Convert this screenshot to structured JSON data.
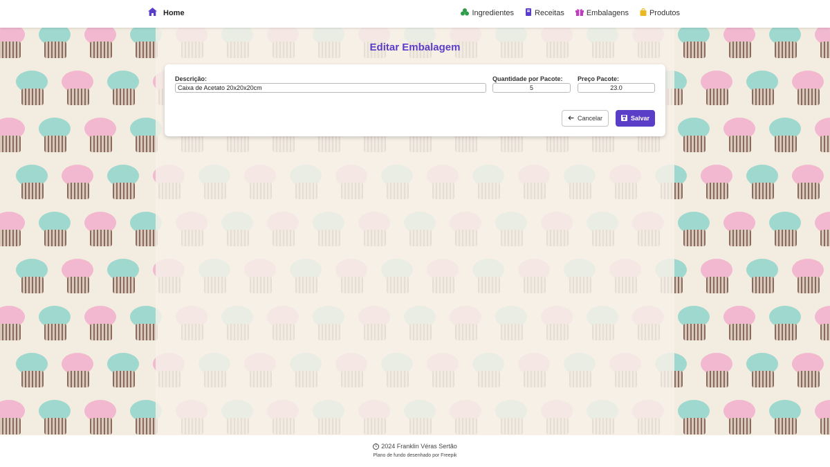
{
  "nav": {
    "home_label": "Home",
    "items": [
      {
        "label": "Ingredientes",
        "icon": "ingredients-icon",
        "color": "#2e9d4a"
      },
      {
        "label": "Receitas",
        "icon": "recipe-book-icon",
        "color": "#5a3ec8"
      },
      {
        "label": "Embalagens",
        "icon": "gift-box-icon",
        "color": "#c03cc0"
      },
      {
        "label": "Produtos",
        "icon": "shopping-bag-icon",
        "color": "#e8b923"
      }
    ]
  },
  "page": {
    "title": "Editar Embalagem"
  },
  "form": {
    "descricao_label": "Descrição:",
    "descricao_value": "Caixa de Acetato 20x20x20cm",
    "quantidade_label": "Quantidade por Pacote:",
    "quantidade_value": "5",
    "preco_label": "Preço Pacote:",
    "preco_value": "23.0",
    "cancel_label": "Cancelar",
    "save_label": "Salvar"
  },
  "footer": {
    "copyright": "2024 Franklin Véras Sertão",
    "credit": "Plano de fundo desenhado por Freepik"
  },
  "colors": {
    "accent": "#5a3ec8",
    "background_pattern_pink": "#f2b8cf",
    "background_pattern_teal": "#9fd8cf",
    "background_pattern_brown": "#8a6a5c",
    "background_cream": "#f3ece0"
  }
}
